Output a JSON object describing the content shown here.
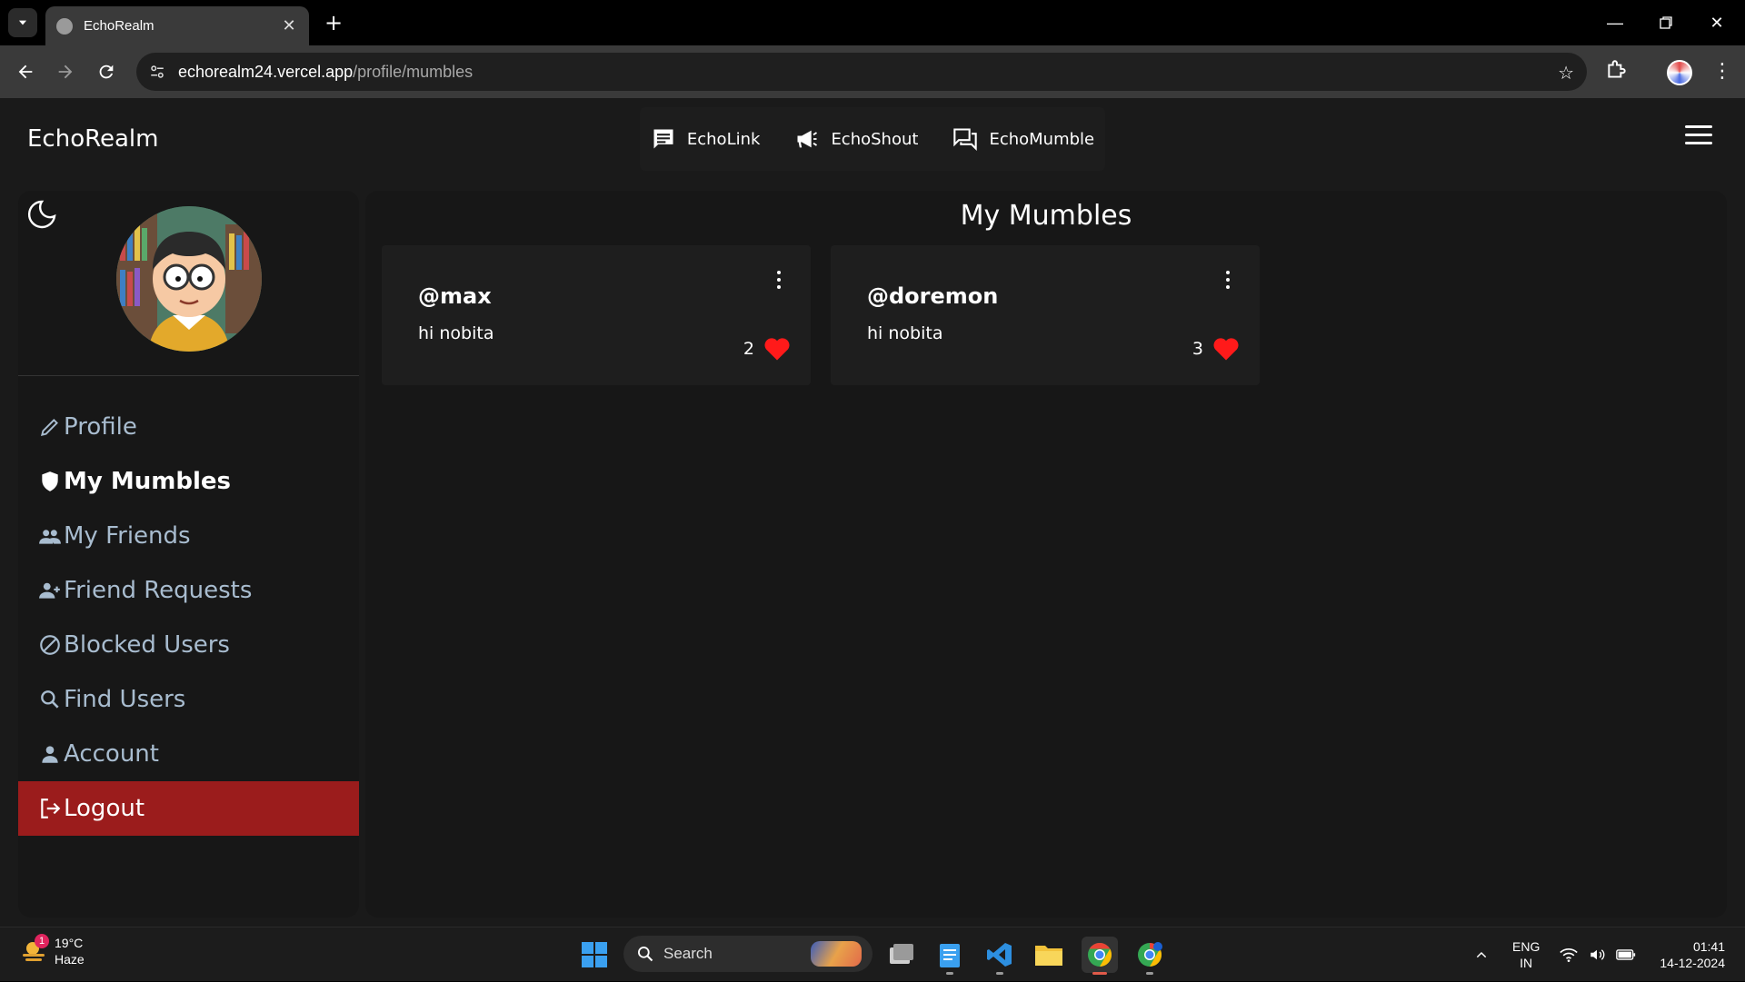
{
  "browser": {
    "tab_title": "EchoRealm",
    "url_host": "echorealm24.vercel.app",
    "url_path": "/profile/mumbles",
    "icons": [
      "tab-list-icon",
      "close-icon",
      "new-tab-icon",
      "minimize-icon",
      "restore-icon",
      "close-window-icon",
      "back-icon",
      "forward-icon",
      "reload-icon",
      "site-info-icon",
      "star-icon",
      "extensions-icon",
      "kebab-icon"
    ]
  },
  "app": {
    "brand": "EchoRealm",
    "nav": [
      {
        "label": "EchoLink",
        "icon": "chat-icon"
      },
      {
        "label": "EchoShout",
        "icon": "megaphone-icon"
      },
      {
        "label": "EchoMumble",
        "icon": "forum-icon"
      }
    ]
  },
  "sidebar": {
    "items": [
      {
        "label": "Profile",
        "icon": "pencil-icon"
      },
      {
        "label": "My Mumbles",
        "icon": "shield-icon"
      },
      {
        "label": "My Friends",
        "icon": "group-icon"
      },
      {
        "label": "Friend Requests",
        "icon": "person-add-icon"
      },
      {
        "label": "Blocked Users",
        "icon": "block-icon"
      },
      {
        "label": "Find Users",
        "icon": "search-icon"
      },
      {
        "label": "Account",
        "icon": "person-icon"
      },
      {
        "label": "Logout",
        "icon": "logout-icon"
      }
    ],
    "active": "My Mumbles"
  },
  "main": {
    "title": "My Mumbles",
    "mumbles": [
      {
        "user": "@max",
        "text": "hi nobita",
        "likes": "2"
      },
      {
        "user": "@doremon",
        "text": "hi nobita",
        "likes": "3"
      }
    ]
  },
  "taskbar": {
    "weather_badge": "1",
    "temperature": "19°C",
    "condition": "Haze",
    "search_label": "Search",
    "lang_top": "ENG",
    "lang_bottom": "IN",
    "time": "01:41",
    "date": "14-12-2024"
  },
  "colors": {
    "page_bg": "#1a1a1a",
    "panel_bg": "#171717",
    "logout_bg": "#9b1c1c",
    "sidebar_text": "#a8bccf",
    "heart": "#ff1a1a"
  }
}
